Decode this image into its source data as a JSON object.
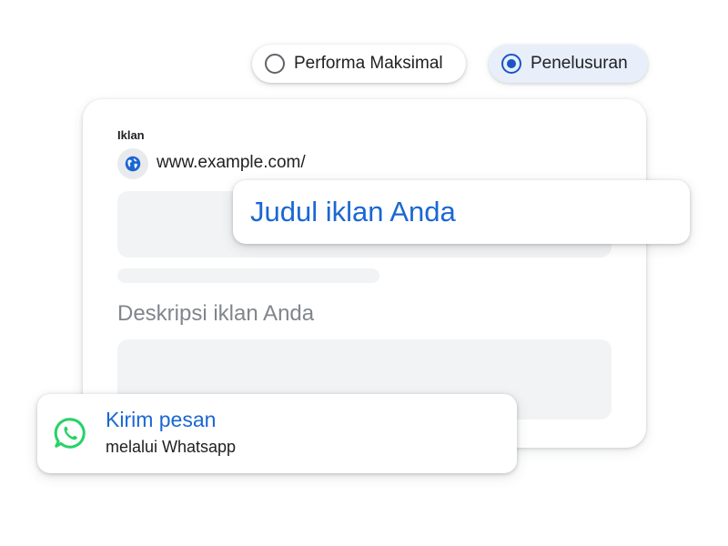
{
  "campaign_type": {
    "options": [
      {
        "label": "Performa Maksimal",
        "selected": false
      },
      {
        "label": "Penelusuran",
        "selected": true
      }
    ]
  },
  "ad_preview": {
    "label": "Iklan",
    "display_url": "www.example.com/",
    "url_icon": "globe-icon",
    "headline": "Judul iklan Anda",
    "description": "Deskripsi iklan Anda"
  },
  "message_extension": {
    "icon": "whatsapp-icon",
    "title": "Kirim pesan",
    "subtitle": "melalui Whatsapp"
  },
  "colors": {
    "accent_blue": "#1a67d2",
    "radio_blue": "#1a56c4",
    "selected_pill_bg": "#e8effb",
    "placeholder_gray": "#f1f3f4",
    "whatsapp_green": "#25d366"
  }
}
